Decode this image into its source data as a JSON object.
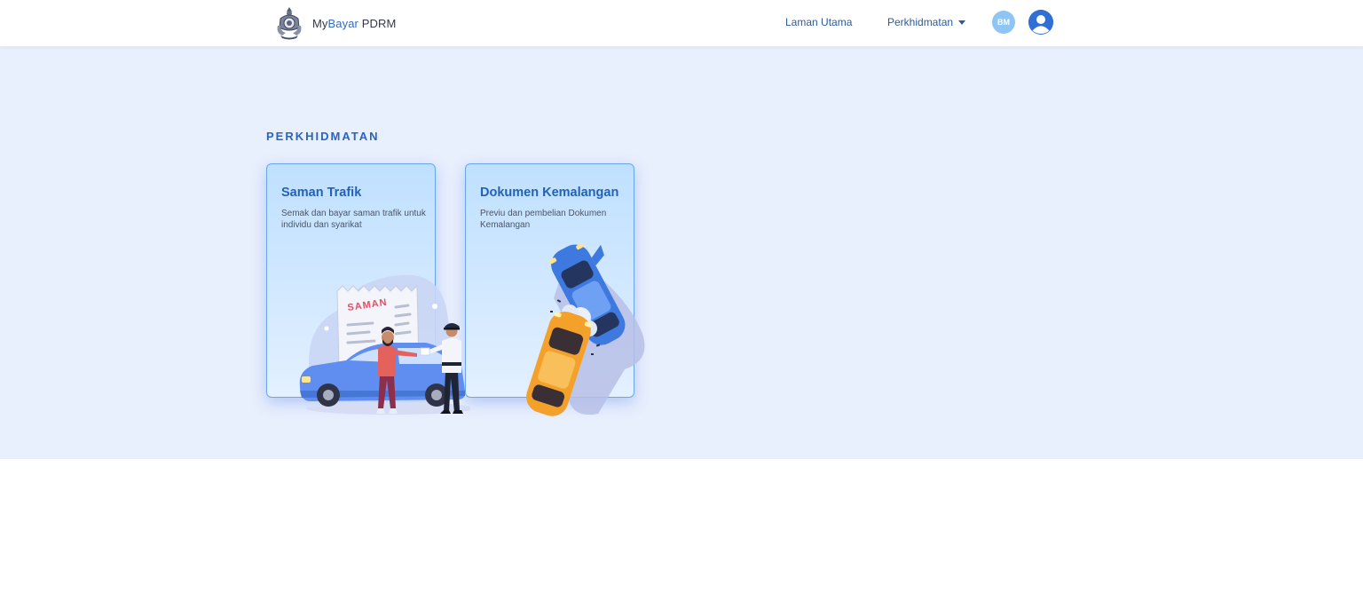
{
  "header": {
    "brand_prefix": "My",
    "brand_accent": "Bayar",
    "brand_suffix": " PDRM",
    "logo_icon": "pdrm-crest-icon",
    "nav": {
      "home": "Laman Utama",
      "services": "Perkhidmatan"
    },
    "language_badge": "BM",
    "profile_icon": "user-circle-icon"
  },
  "section": {
    "title": "PERKHIDMATAN"
  },
  "cards": [
    {
      "title": "Saman Trafik",
      "description": "Semak dan bayar saman trafik untuk individu dan syarikat",
      "illustration_label": "SAMAN"
    },
    {
      "title": "Dokumen Kemalangan",
      "description": "Previu dan pembelian Dokumen Kemalangan"
    }
  ],
  "colors": {
    "primary": "#2a63c2",
    "band_background": "#e8effd",
    "card_border": "#6aa6ec",
    "badge": "#8fc5f3",
    "avatar": "#2f6fd6"
  }
}
